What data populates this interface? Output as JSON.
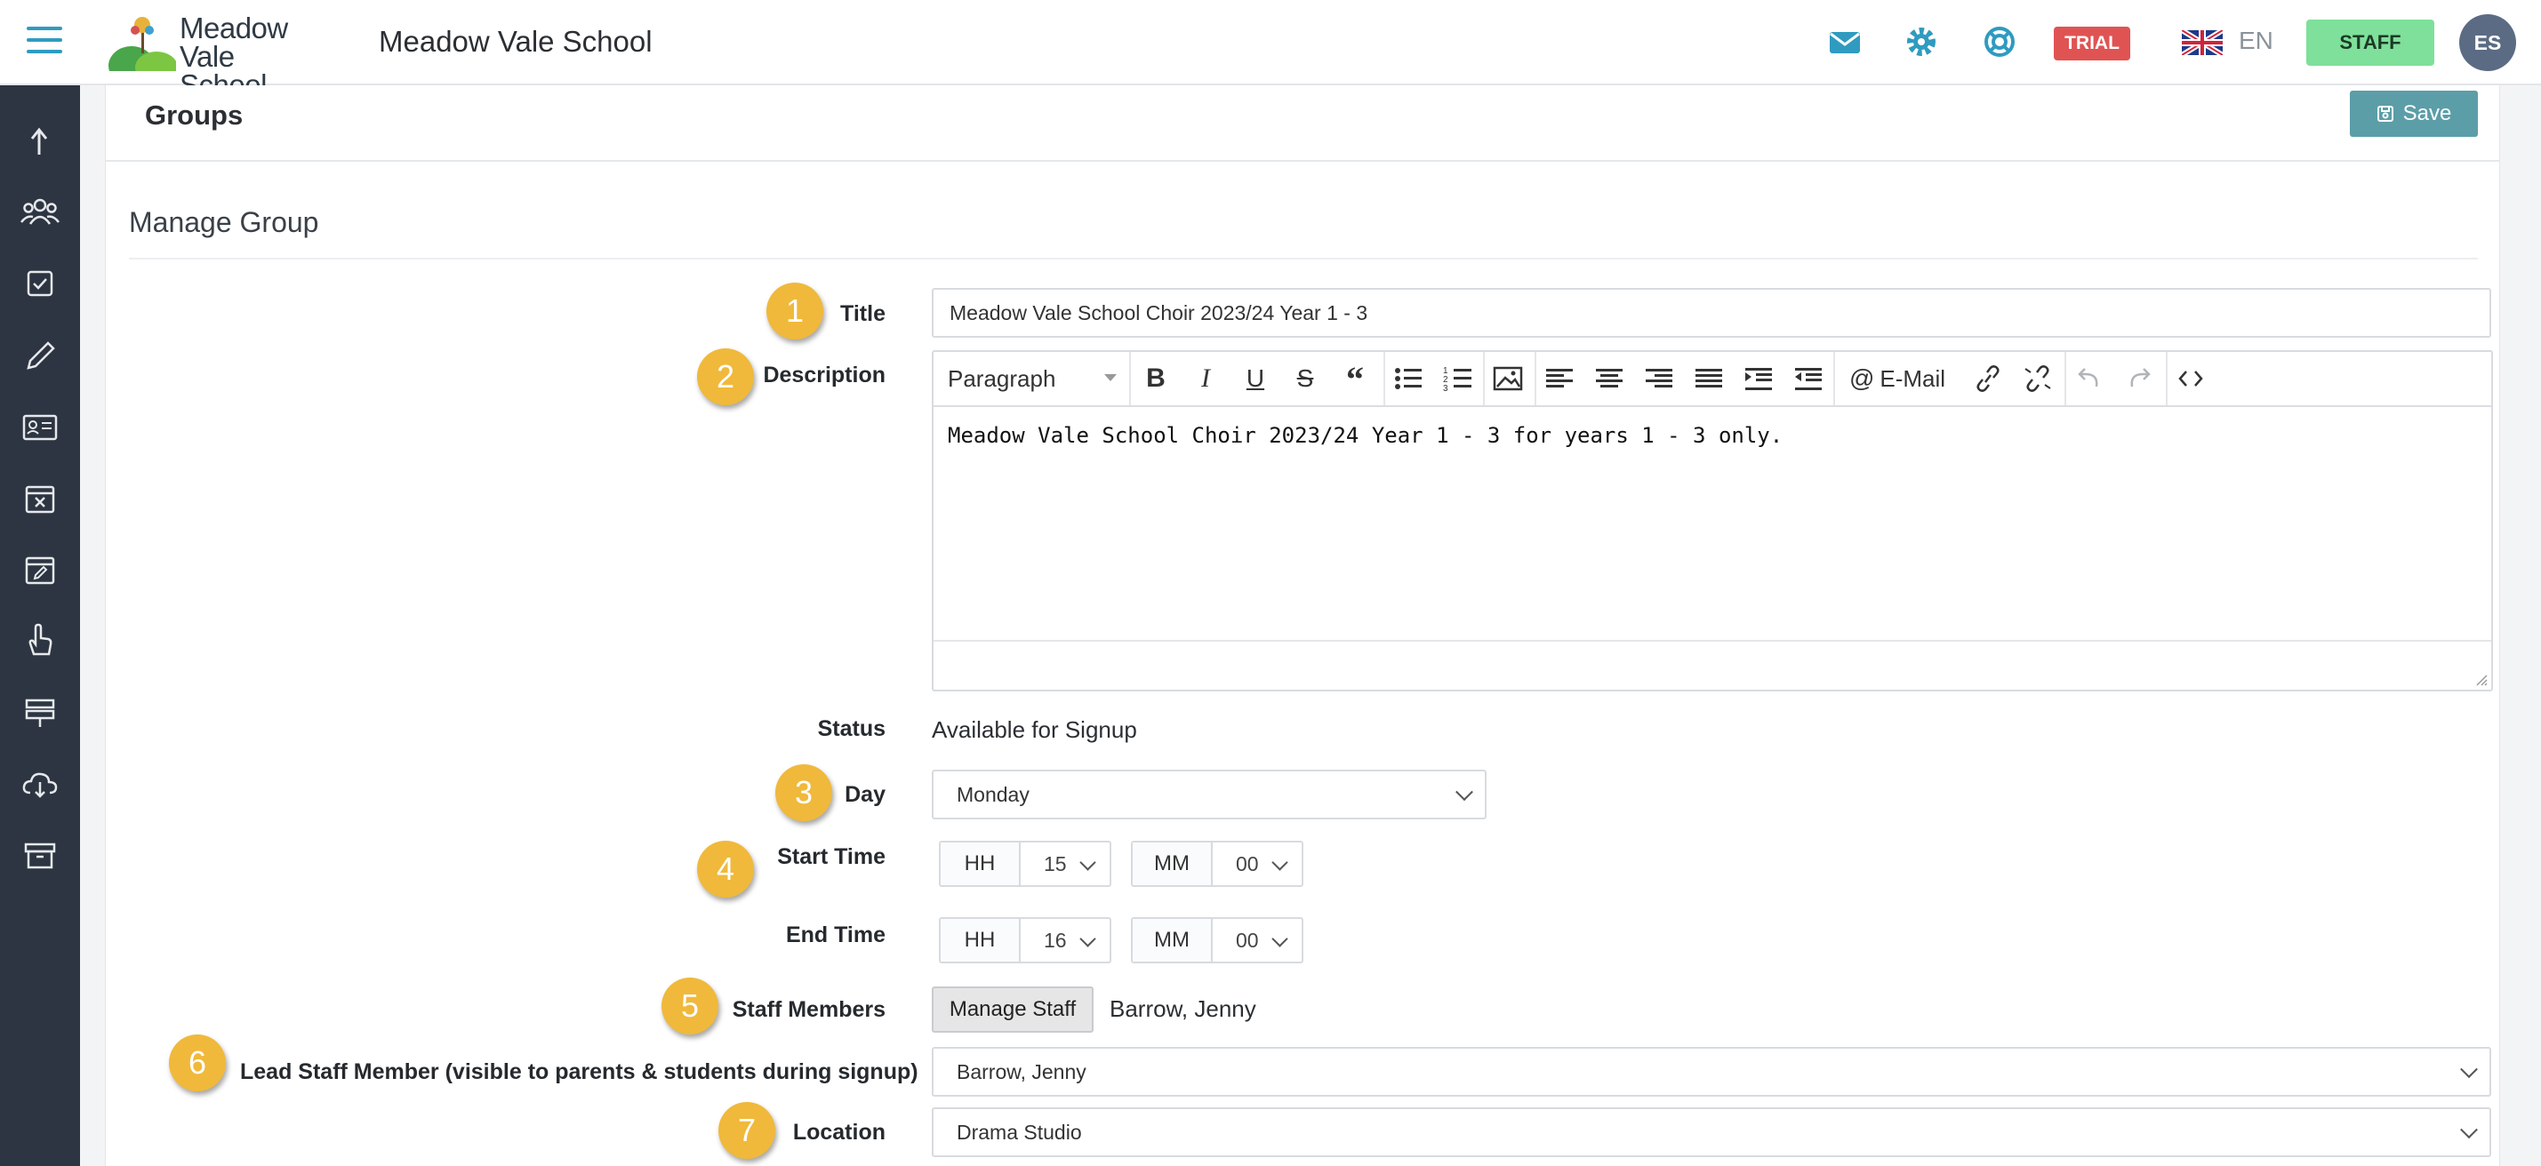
{
  "header": {
    "logo_line1": "Meadow",
    "logo_line2": "Vale School",
    "school_name": "Meadow Vale School",
    "trial_badge": "TRIAL",
    "language": "EN",
    "staff_button": "STAFF",
    "avatar_initials": "ES",
    "icons": [
      "mail-icon",
      "gear-icon",
      "help-lifebuoy-icon",
      "uk-flag-icon"
    ],
    "accent_color": "#2f9bc0"
  },
  "sidebar": {
    "icons": [
      "upload-arrow-icon",
      "people-icon",
      "checkbox-icon",
      "pencil-icon",
      "id-card-icon",
      "calendar-x-icon",
      "calendar-edit-icon",
      "hand-pointer-icon",
      "signpost-icon",
      "cloud-download-icon",
      "archive-icon"
    ]
  },
  "panel": {
    "title": "Groups",
    "save_label": "Save",
    "section_title": "Manage Group"
  },
  "form": {
    "title": {
      "label": "Title",
      "value": "Meadow Vale School Choir 2023/24 Year 1 - 3"
    },
    "description": {
      "label": "Description",
      "format": "Paragraph",
      "email_label": "E-Mail",
      "content": "Meadow Vale School Choir 2023/24 Year 1 - 3 for years 1 - 3 only."
    },
    "status": {
      "label": "Status",
      "value": "Available for Signup"
    },
    "day": {
      "label": "Day",
      "value": "Monday"
    },
    "start_time": {
      "label": "Start Time",
      "hh_label": "HH",
      "hh": "15",
      "mm_label": "MM",
      "mm": "00"
    },
    "end_time": {
      "label": "End Time",
      "hh_label": "HH",
      "hh": "16",
      "mm_label": "MM",
      "mm": "00"
    },
    "staff": {
      "label": "Staff Members",
      "button": "Manage Staff",
      "value": "Barrow, Jenny"
    },
    "lead_staff": {
      "label": "Lead Staff Member (visible to parents & students during signup)",
      "value": "Barrow, Jenny"
    },
    "location": {
      "label": "Location",
      "value": "Drama Studio"
    }
  },
  "annotations": [
    "1",
    "2",
    "3",
    "4",
    "5",
    "6",
    "7"
  ],
  "colors": {
    "badge": "#f0b93b",
    "save": "#5b9ea8",
    "staff": "#7ee09a",
    "trial": "#e05353",
    "sidebar": "#2d3542"
  }
}
